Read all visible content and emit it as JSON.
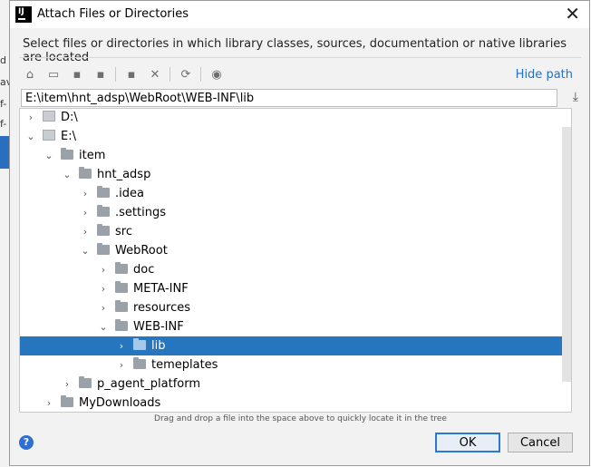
{
  "backdrop": {
    "snippets": [
      "d",
      "av",
      "f-",
      "f-"
    ]
  },
  "window": {
    "title": "Attach Files or Directories",
    "app_icon_text": "IJ"
  },
  "description": "Select files or directories in which library classes, sources, documentation or native libraries are located",
  "toolbar": {
    "buttons": [
      {
        "name": "home-icon",
        "glyph": "⌂"
      },
      {
        "name": "desktop-icon",
        "glyph": "▭"
      },
      {
        "name": "project-icon",
        "glyph": "▪"
      },
      {
        "name": "module-icon",
        "glyph": "▪"
      },
      {
        "name": "new-folder-icon",
        "glyph": "▪"
      },
      {
        "name": "delete-icon",
        "glyph": "✕"
      },
      {
        "name": "refresh-icon",
        "glyph": "⟳"
      },
      {
        "name": "show-hidden-icon",
        "glyph": "◉"
      }
    ],
    "hide_path": "Hide path"
  },
  "path": {
    "value": "E:\\item\\hnt_adsp\\WebRoot\\WEB-INF\\lib"
  },
  "tree": [
    {
      "label": "D:\\",
      "depth": 0,
      "expanded": false,
      "type": "drive"
    },
    {
      "label": "E:\\",
      "depth": 0,
      "expanded": true,
      "type": "drive"
    },
    {
      "label": "item",
      "depth": 1,
      "expanded": true,
      "type": "folder"
    },
    {
      "label": "hnt_adsp",
      "depth": 2,
      "expanded": true,
      "type": "folder"
    },
    {
      "label": ".idea",
      "depth": 3,
      "expanded": false,
      "type": "folder"
    },
    {
      "label": ".settings",
      "depth": 3,
      "expanded": false,
      "type": "folder"
    },
    {
      "label": "src",
      "depth": 3,
      "expanded": false,
      "type": "folder"
    },
    {
      "label": "WebRoot",
      "depth": 3,
      "expanded": true,
      "type": "folder"
    },
    {
      "label": "doc",
      "depth": 4,
      "expanded": false,
      "type": "folder"
    },
    {
      "label": "META-INF",
      "depth": 4,
      "expanded": false,
      "type": "folder"
    },
    {
      "label": "resources",
      "depth": 4,
      "expanded": false,
      "type": "folder"
    },
    {
      "label": "WEB-INF",
      "depth": 4,
      "expanded": true,
      "type": "folder"
    },
    {
      "label": "lib",
      "depth": 5,
      "expanded": false,
      "type": "folder",
      "selected": true
    },
    {
      "label": "temeplates",
      "depth": 5,
      "expanded": false,
      "type": "folder"
    },
    {
      "label": "p_agent_platform",
      "depth": 2,
      "expanded": false,
      "type": "folder"
    },
    {
      "label": "MyDownloads",
      "depth": 1,
      "expanded": false,
      "type": "folder"
    }
  ],
  "hint": "Drag and drop a file into the space above to quickly locate it in the tree",
  "buttons": {
    "help": "?",
    "ok": "OK",
    "cancel": "Cancel"
  },
  "colors": {
    "selection": "#2675bf",
    "link": "#2470c5",
    "ok_border": "#2b79d3"
  }
}
